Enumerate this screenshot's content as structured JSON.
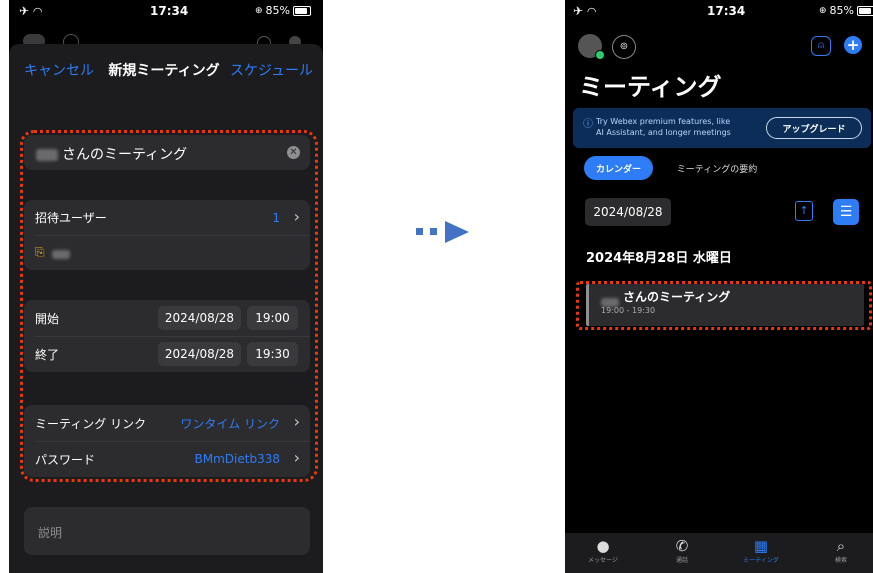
{
  "status_bar": {
    "time": "17:34",
    "battery": "85%",
    "left_icons": [
      "airplane-icon",
      "wifi-icon"
    ]
  },
  "left_screen": {
    "nav": {
      "cancel": "キャンセル",
      "title": "新規ミーティング",
      "schedule": "スケジュール"
    },
    "meeting_title": "さんのミーティング",
    "invite": {
      "label": "招待ユーザー",
      "count": "1"
    },
    "start": {
      "label": "開始",
      "date": "2024/08/28",
      "time": "19:00"
    },
    "end": {
      "label": "終了",
      "date": "2024/08/28",
      "time": "19:30"
    },
    "link": {
      "label": "ミーティング リンク",
      "value": "ワンタイム リンク"
    },
    "password": {
      "label": "パスワード",
      "value": "BMmDietb338"
    },
    "description_placeholder": "説明"
  },
  "right_screen": {
    "title": "ミーティング",
    "banner": {
      "text_line1": "Try Webex premium features, like",
      "text_line2": "AI Assistant, and longer meetings",
      "button": "アップグレード"
    },
    "tabs": [
      "カレンダー",
      "ミーティングの要約"
    ],
    "date_field": "2024/08/28",
    "date_heading": "2024年8月28日 水曜日",
    "meeting": {
      "title": "さんのミーティング",
      "time": "19:00 - 19:30"
    },
    "bottom_nav": [
      "メッセージ",
      "通話",
      "ミーティング",
      "検索"
    ]
  },
  "colors": {
    "accent_blue": "#2e7cf6",
    "highlight_red": "#e8380d",
    "arrow_blue": "#4472c4",
    "banner_bg": "#0c2d57"
  }
}
